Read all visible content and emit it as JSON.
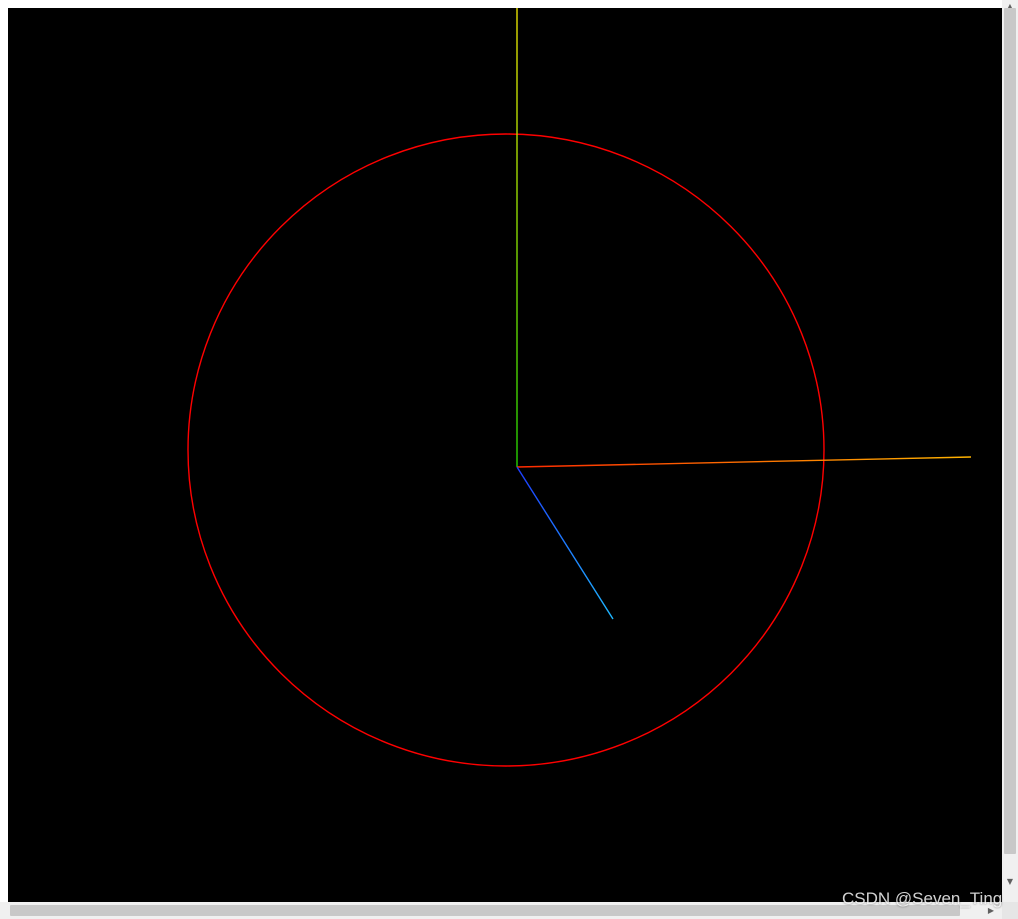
{
  "scene": {
    "background_color": "#000000",
    "circle_color": "#ff0000",
    "axis_x_colors": [
      "#ff0000",
      "#ffa500"
    ],
    "axis_y_colors": [
      "#00ff00",
      "#ffff00"
    ],
    "axis_z_colors": [
      "#0000ff",
      "#00bfff"
    ]
  },
  "scrollbars": {
    "vertical_up_icon": "arrow-up-icon",
    "vertical_down_icon": "arrow-down-icon",
    "horizontal_right_icon": "arrow-right-icon"
  },
  "watermark": {
    "text": "CSDN @Seven_Ting"
  }
}
